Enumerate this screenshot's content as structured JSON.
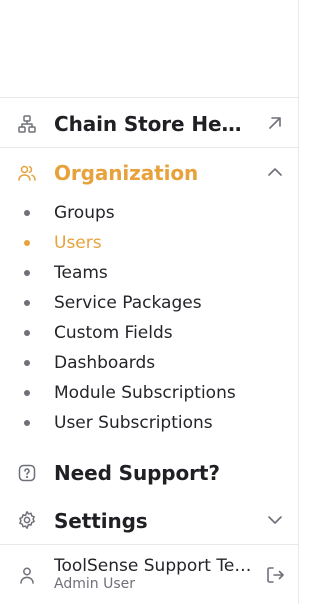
{
  "colors": {
    "accent": "#e7a23c",
    "text": "#1f1f24",
    "muted": "#6f7079",
    "divider": "#e9e9ec"
  },
  "sidebar": {
    "chain_store": {
      "label": "Chain Store Headquarters",
      "icon": "hierarchy-icon",
      "action_icon": "external-arrow-icon"
    },
    "organization": {
      "label": "Organization",
      "icon": "users-icon",
      "toggle_icon": "chevron-up-icon",
      "expanded": true,
      "items": [
        {
          "label": "Groups",
          "active": false
        },
        {
          "label": "Users",
          "active": true
        },
        {
          "label": "Teams",
          "active": false
        },
        {
          "label": "Service Packages",
          "active": false
        },
        {
          "label": "Custom Fields",
          "active": false
        },
        {
          "label": "Dashboards",
          "active": false
        },
        {
          "label": "Module Subscriptions",
          "active": false
        },
        {
          "label": "User Subscriptions",
          "active": false
        }
      ]
    },
    "support": {
      "label": "Need Support?",
      "icon": "help-icon"
    },
    "settings": {
      "label": "Settings",
      "icon": "gear-icon",
      "toggle_icon": "chevron-down-icon"
    },
    "user": {
      "name": "ToolSense Support Team",
      "role": "Admin User",
      "icon": "user-icon",
      "action_icon": "logout-icon"
    }
  }
}
